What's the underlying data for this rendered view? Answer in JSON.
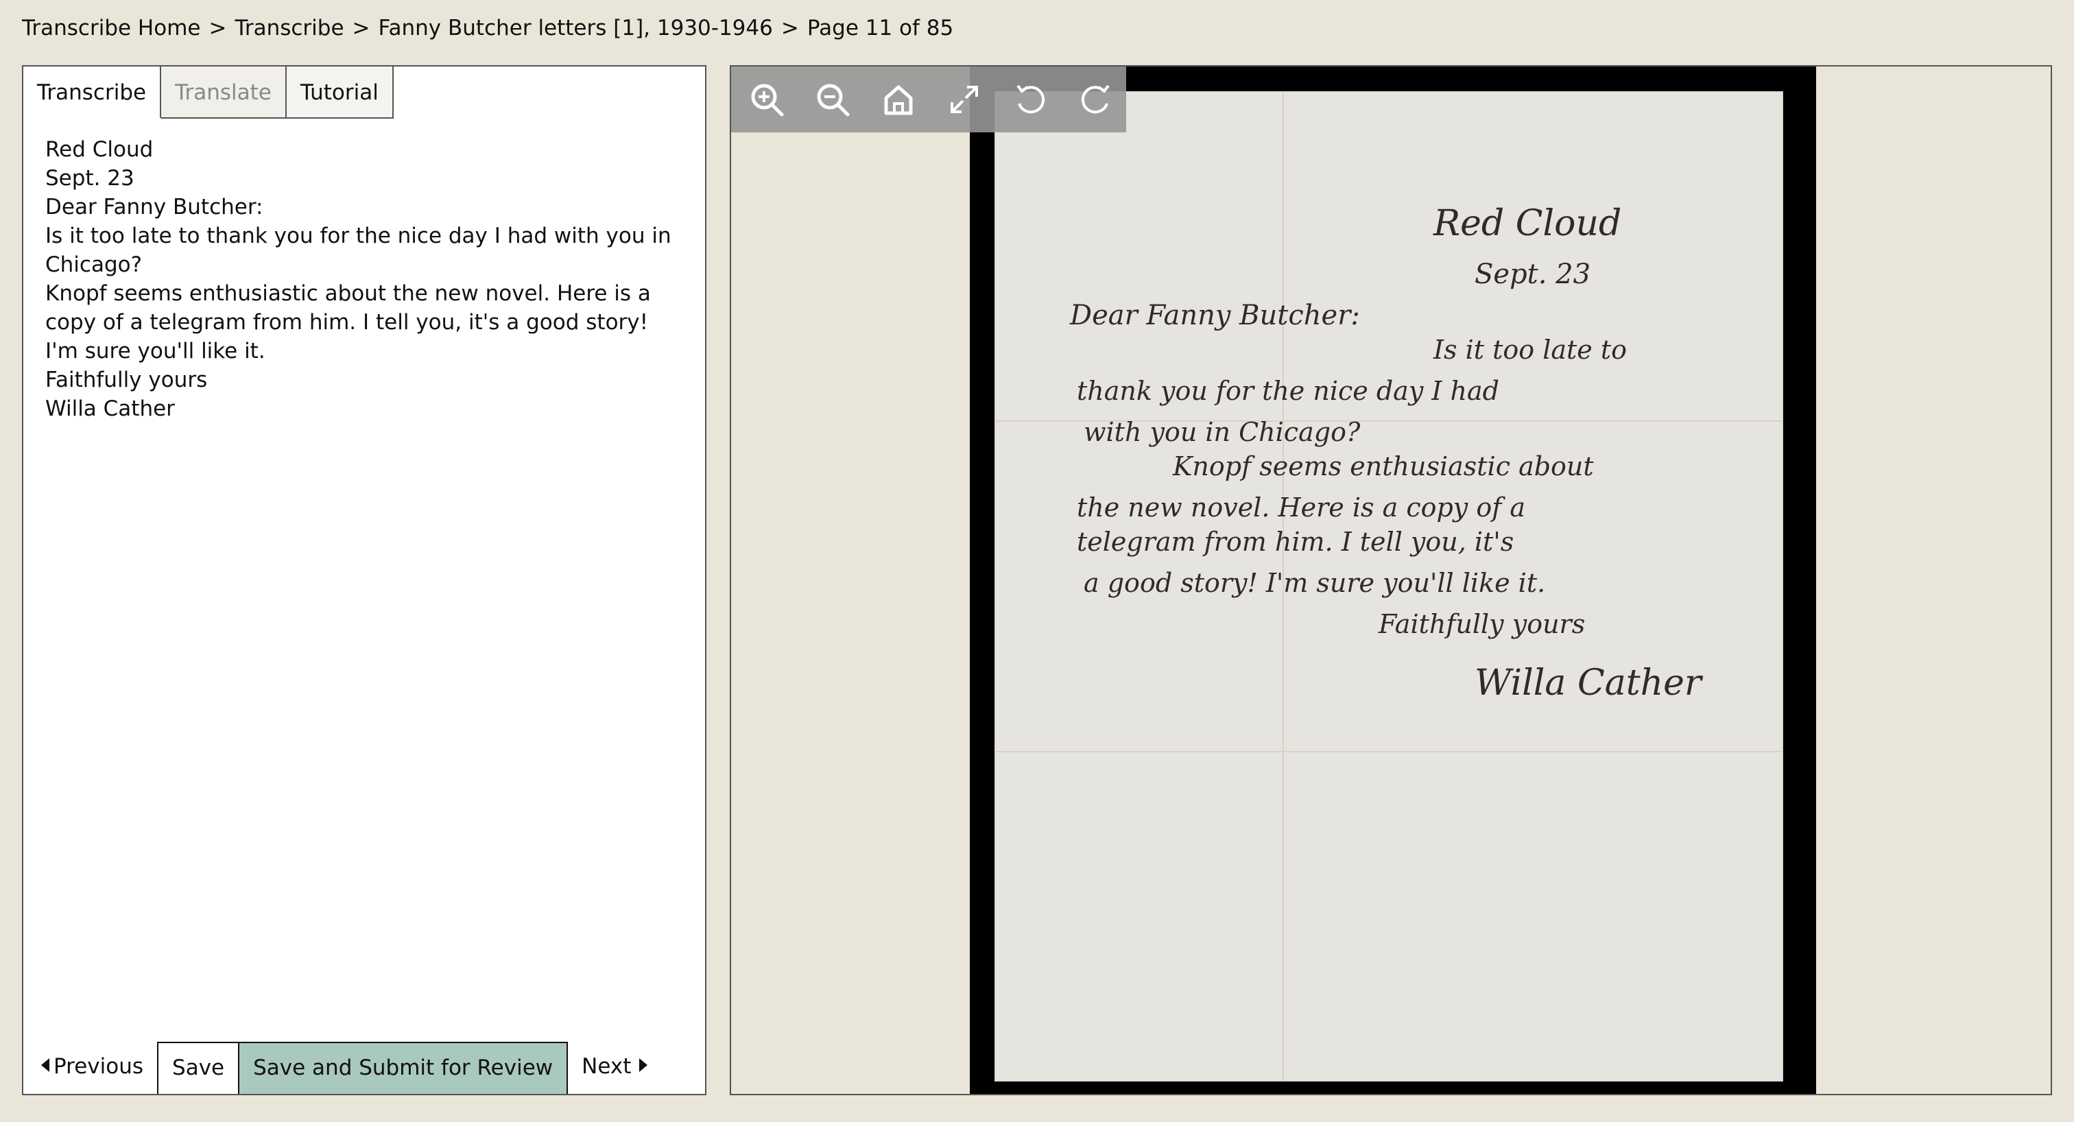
{
  "breadcrumb": {
    "items": [
      "Transcribe Home",
      "Transcribe",
      "Fanny Butcher letters [1], 1930-1946",
      "Page 11 of 85"
    ],
    "separator": ">"
  },
  "tabs": [
    {
      "label": "Transcribe",
      "state": "active"
    },
    {
      "label": "Translate",
      "state": "disabled"
    },
    {
      "label": "Tutorial",
      "state": "normal"
    }
  ],
  "transcription": {
    "lines": [
      "Red Cloud",
      "Sept. 23",
      "Dear Fanny Butcher:",
      "Is it too late to thank you for the nice day I had with you in",
      "Chicago?",
      "Knopf seems enthusiastic about the new novel. Here is a",
      "copy of a telegram from him. I tell you, it's a good story!",
      "I'm sure you'll like it.",
      "Faithfully yours",
      "Willa Cather"
    ]
  },
  "buttons": {
    "previous": "Previous",
    "save": "Save",
    "submit": "Save and Submit for Review",
    "next": "Next"
  },
  "viewer": {
    "toolbar": [
      "zoom-in-icon",
      "zoom-out-icon",
      "home-icon",
      "fullscreen-icon",
      "rotate-left-icon",
      "rotate-right-icon"
    ]
  },
  "letter_image": {
    "handwriting": [
      "Red Cloud",
      "Sept. 23",
      "Dear Fanny Butcher:",
      "Is it too late to",
      "thank you for the nice day I had",
      "with you in Chicago?",
      "Knopf seems enthusiastic about",
      "the new novel. Here is a copy of a",
      "telegram from him. I tell you, it's",
      "a good story! I'm sure you'll like it.",
      "Faithfully yours",
      "Willa Cather"
    ]
  },
  "colors": {
    "page_background": "#e9e5d9",
    "submit_button": "#a9c8c0",
    "toolbar": "#969696"
  }
}
